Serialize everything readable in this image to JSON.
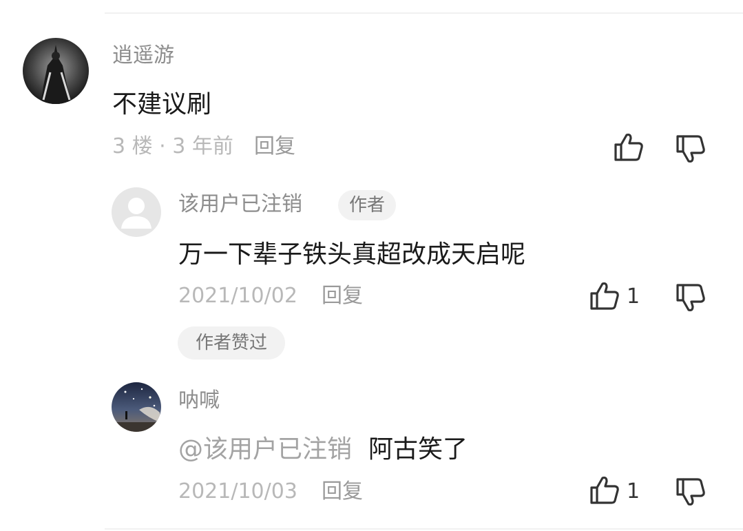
{
  "comments": [
    {
      "username": "逍遥游",
      "text": "不建议刷",
      "meta": "3 楼 · 3 年前",
      "reply_label": "回复",
      "like_count": ""
    }
  ],
  "replies": [
    {
      "username": "该用户已注销",
      "author_badge": "作者",
      "text": "万一下辈子铁头真超改成天启呢",
      "date": "2021/10/02",
      "reply_label": "回复",
      "like_count": "1",
      "liked_by_author": "作者赞过"
    },
    {
      "username": "呐喊",
      "mention": "@该用户已注销",
      "text": "阿古笑了",
      "date": "2021/10/03",
      "reply_label": "回复",
      "like_count": "1"
    }
  ],
  "icons": {
    "like": "thumbs-up-icon",
    "dislike": "thumbs-down-icon",
    "default_avatar": "user-silhouette-icon"
  },
  "colors": {
    "username": "#8d8d8d",
    "content": "#1a1a1a",
    "meta": "#b8b8b8",
    "pill_bg": "#f2f2f2"
  }
}
